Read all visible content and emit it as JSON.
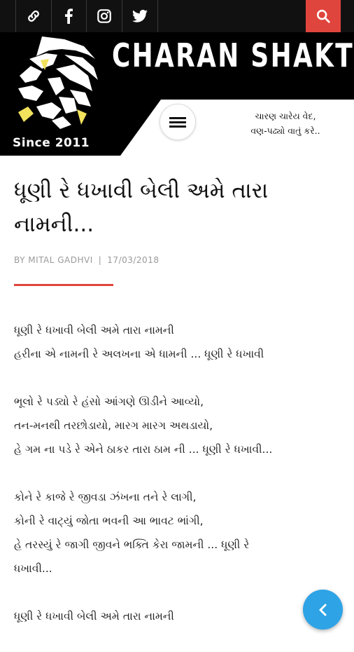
{
  "topbar": {
    "social_icons": [
      "link-icon",
      "facebook-icon",
      "instagram-icon",
      "twitter-icon"
    ],
    "search_icon": "search-icon",
    "accent_color": "#e0453d"
  },
  "header": {
    "brand": "CHARAN SHAKTI",
    "since": "Since 2011",
    "tagline_line1": "ચારણ ચારેય વેદ,",
    "tagline_line2": "વણ-પઢ્યો વાતું કરે..",
    "menu_icon": "hamburger-menu-icon"
  },
  "article": {
    "title": "ધૂણી રે ધખાવી બેલી અમે તારા નામની...",
    "author": "BY MITAL GADHVI",
    "date": "17/03/2018",
    "stanzas": [
      [
        "ધૂણી રે ધખાવી બેલી અમે તારા નામની",
        "હરીના એ નામની રે અલખના એ ધામની ... ધૂણી રે ધખાવી"
      ],
      [
        "ભૂલો રે પડ્યો રે હંસો આંગણે ઊડીને આવ્યો,",
        "તન-મનથી તરછોડાયો, મારગ મારગ અથડાયો,",
        "હે ગમ ના પડે રે એને ઠાકર તારા ઠામ ની ... ધૂણી રે ધખાવી..."
      ],
      [
        "કોને રે કાજે રે જીવડા ઝંખના તને રે લાગી,",
        "કોની રે વાટ્યું જોતા ભવની આ ભાવટ ભાંગી,",
        "હે તરસ્યું રે જાગી જીવને ભક્તિ કેરા જામની ... ધૂણી રે",
        "ધખાવી..."
      ],
      [
        "ધૂણી રે ધખાવી બેલી અમે તારા નામની"
      ]
    ]
  },
  "back_button_icon": "chevron-left-icon"
}
